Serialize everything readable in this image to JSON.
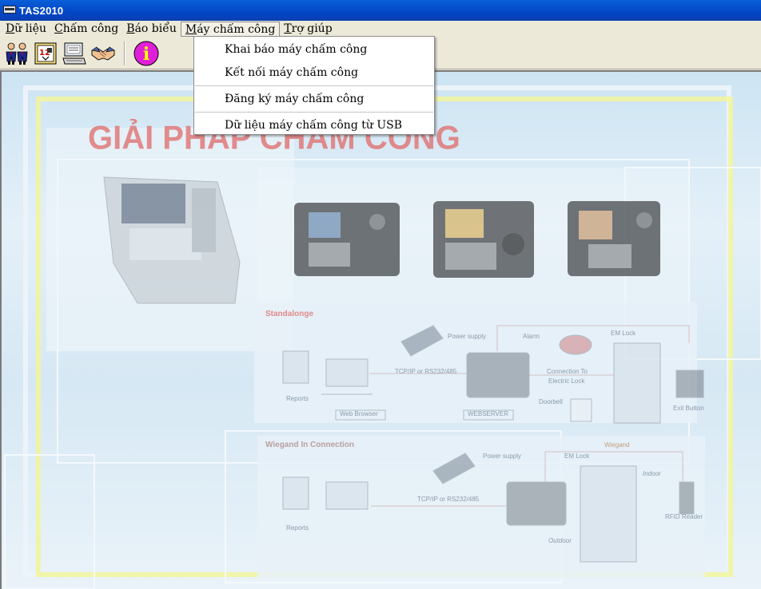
{
  "window": {
    "title": "TAS2010"
  },
  "menubar": {
    "items": [
      {
        "label": "Dữ liệu",
        "accel": "D",
        "rest": "ữ liệu"
      },
      {
        "label": "Chấm công",
        "accel": "C",
        "rest": "hấm công"
      },
      {
        "label": "Báo biểu",
        "accel": "B",
        "rest": "áo biểu"
      },
      {
        "label": "Máy chấm công",
        "accel": "M",
        "rest": "áy chấm công"
      },
      {
        "label": "Trợ giúp",
        "accel": "T",
        "rest": "rợ giúp"
      }
    ]
  },
  "dropdown": {
    "items": [
      {
        "label": "Khai báo máy chấm công"
      },
      {
        "label": "Kết nối máy chấm công"
      },
      {
        "label": "Đăng ký máy chấm công"
      },
      {
        "label": "Dữ liệu máy chấm công từ USB"
      }
    ]
  },
  "toolbar": {
    "icons": [
      "employees-icon",
      "calendar-icon",
      "report-icon",
      "handshake-icon",
      "info-icon"
    ],
    "info_glyph": "i"
  },
  "background": {
    "banner_text": "GIẢI PHÁP CHẤM CÔNG",
    "section1_title": "Standalonge",
    "section2_title": "Wiegand In Connection",
    "labels": {
      "power_supply": "Power supply",
      "alarm": "Alarm",
      "em_lock": "EM Lock",
      "reports": "Reports",
      "tcpip": "TCP/IP or RS232/485",
      "connection_to": "Connection To",
      "electric_lock": "Electric Lock",
      "doorbell": "Doorbell",
      "exit_button": "Exit Button",
      "web_browser": "Web Browser",
      "webserver": "WEBSERVER",
      "wiegand": "Wiegand",
      "indoor": "Indoor",
      "outdoor": "Outdoor",
      "rfid_reader": "RFID Reader"
    }
  },
  "colors": {
    "title_bar": "#0346c6",
    "menu_bg": "#ece9d8",
    "client_bg": "#d6e8f4",
    "banner_red": "#e07a7a",
    "frame_yellow": "#f2f59a"
  }
}
